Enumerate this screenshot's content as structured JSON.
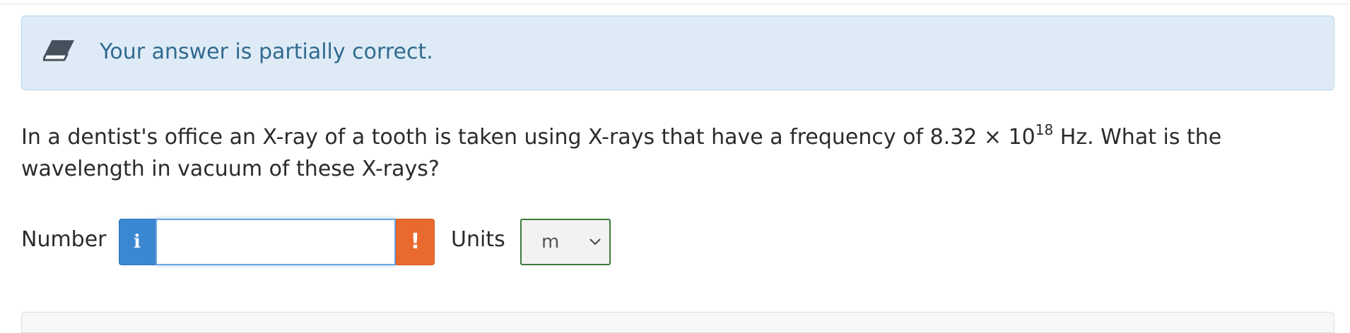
{
  "feedback": {
    "icon": "eraser-icon",
    "message": "Your answer is partially correct.",
    "color": "#316a8f",
    "background": "#deebf6"
  },
  "question": {
    "text_before": "In a dentist's office an X-ray of a tooth is taken using X-rays that have a frequency of 8.32 × 10",
    "exponent": "18",
    "text_after": " Hz. What is the wavelength in vacuum of these X-rays?"
  },
  "answer": {
    "number_label": "Number",
    "info_button": "i",
    "number_value": "",
    "warning_badge": "!",
    "units_label": "Units",
    "units_selected": "m"
  },
  "colors": {
    "info": "#3b87d2",
    "warning": "#ea6a2e",
    "units_border": "#3f7a3a"
  }
}
